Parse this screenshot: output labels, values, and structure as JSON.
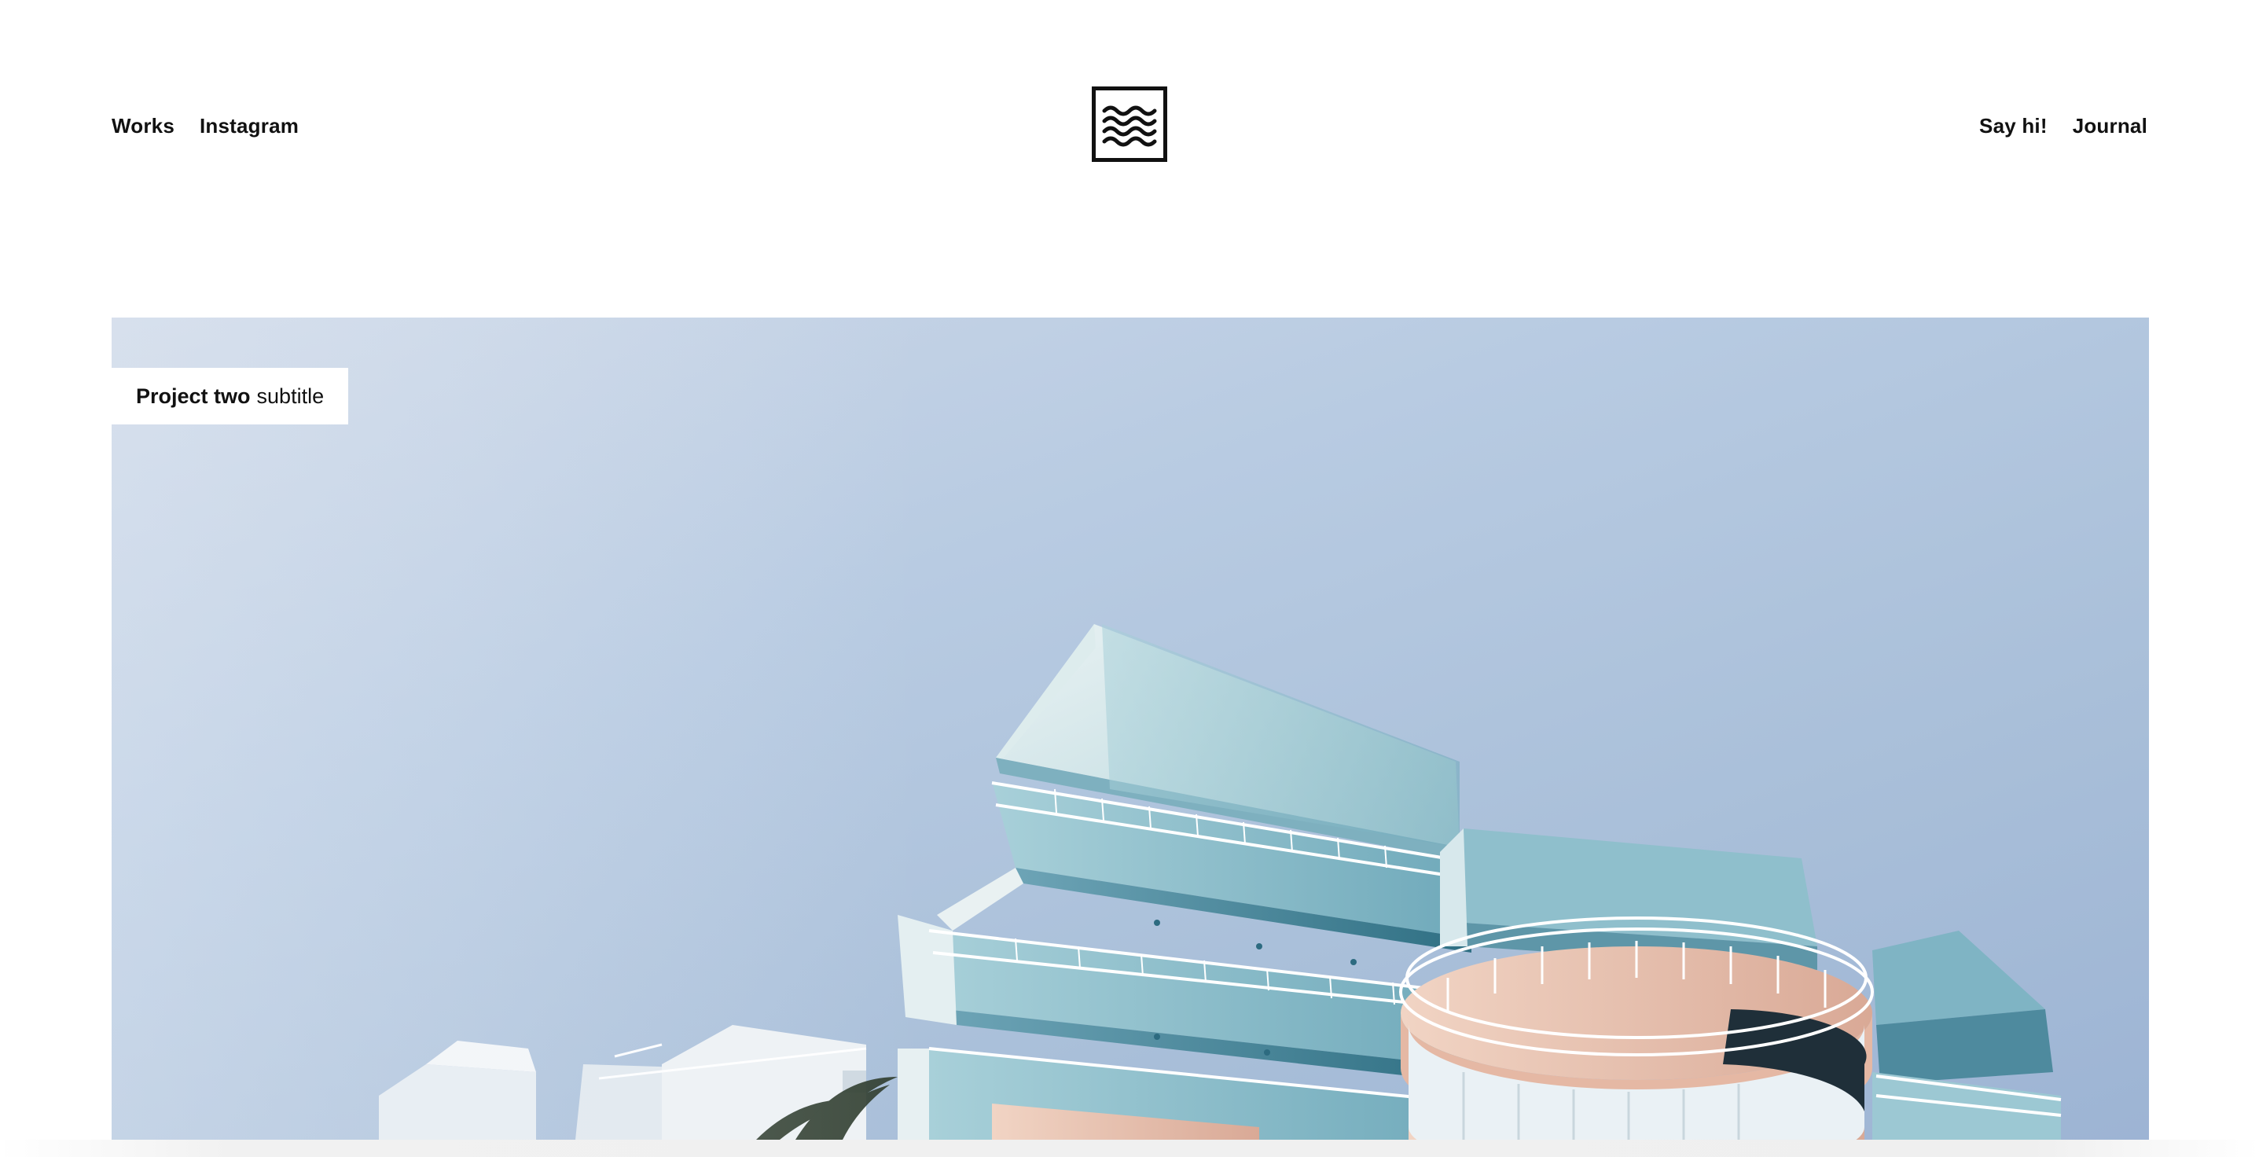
{
  "header": {
    "nav_left": [
      {
        "label": "Works"
      },
      {
        "label": "Instagram"
      }
    ],
    "nav_right": [
      {
        "label": "Say hi!"
      },
      {
        "label": "Journal"
      }
    ],
    "logo_icon": "waves-logo-icon"
  },
  "hero": {
    "project_title": "Project two",
    "project_subtitle": "subtitle",
    "image_description_icon": "building-photo"
  },
  "colors": {
    "text": "#111111",
    "background": "#ffffff",
    "sky": "#b8cbe2",
    "building_teal": "#9ccad6",
    "building_pink": "#e9c3b1"
  }
}
